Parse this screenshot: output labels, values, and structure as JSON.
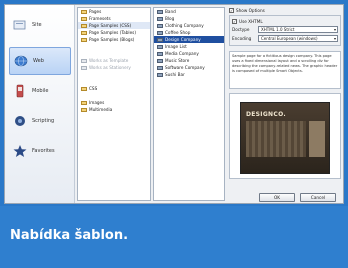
{
  "categories": [
    {
      "label": "Site",
      "icon": "site-icon",
      "selected": false
    },
    {
      "label": "Web",
      "icon": "globe-icon",
      "selected": true
    },
    {
      "label": "Mobile",
      "icon": "mobile-icon",
      "selected": false
    },
    {
      "label": "Scripting",
      "icon": "script-icon",
      "selected": false
    },
    {
      "label": "Favorites",
      "icon": "star-icon",
      "selected": false
    }
  ],
  "list1": [
    {
      "label": "Pages",
      "selected": false,
      "dim": false
    },
    {
      "label": "Framesets",
      "selected": false,
      "dim": false
    },
    {
      "label": "Page Samples (CSS)",
      "selected": true,
      "dim": false
    },
    {
      "label": "Page Samples (Tables)",
      "selected": false,
      "dim": false
    },
    {
      "label": "Page Samples (Blogs)",
      "selected": false,
      "dim": false
    },
    {
      "label": "",
      "selected": false,
      "dim": false
    },
    {
      "label": "",
      "selected": false,
      "dim": false
    },
    {
      "label": "Works as Template",
      "selected": false,
      "dim": true
    },
    {
      "label": "Works as Stationery",
      "selected": false,
      "dim": true
    },
    {
      "label": "",
      "selected": false,
      "dim": false
    },
    {
      "label": "",
      "selected": false,
      "dim": false
    },
    {
      "label": "CSS",
      "selected": false,
      "dim": false
    },
    {
      "label": "",
      "selected": false,
      "dim": false
    },
    {
      "label": "Images",
      "selected": false,
      "dim": false
    },
    {
      "label": "Multimedia",
      "selected": false,
      "dim": false
    }
  ],
  "list2": [
    {
      "label": "Band",
      "selected": false
    },
    {
      "label": "Blog",
      "selected": false
    },
    {
      "label": "Clothing Company",
      "selected": false
    },
    {
      "label": "Coffee Shop",
      "selected": false
    },
    {
      "label": "Design Company",
      "selected": true
    },
    {
      "label": "Image List",
      "selected": false
    },
    {
      "label": "Media Company",
      "selected": false
    },
    {
      "label": "Music Store",
      "selected": false
    },
    {
      "label": "Software Company",
      "selected": false
    },
    {
      "label": "Sushi Bar",
      "selected": false
    }
  ],
  "options": {
    "show_options_label": "Show Options",
    "use_xhtml_label": "Use XHTML",
    "doctype_label": "Doctype",
    "doctype_value": "XHTML 1.0 Strict",
    "encoding_label": "Encoding",
    "encoding_value": "Central European (windows)"
  },
  "description": "Sample page for a fictitious design company. This page uses a fixed dimensional layout and a scrolling div for describing the company-related news. The graphic header is composed of multiple Smart Objects.",
  "preview": {
    "brand_text": "DESIGNCO."
  },
  "buttons": {
    "ok": "OK",
    "cancel": "Cancel"
  },
  "caption": "Nabídka šablon.",
  "colors": {
    "frame": "#2a78c8",
    "caption_bg": "#2f7fcf",
    "selection": "#1f4fa0"
  }
}
